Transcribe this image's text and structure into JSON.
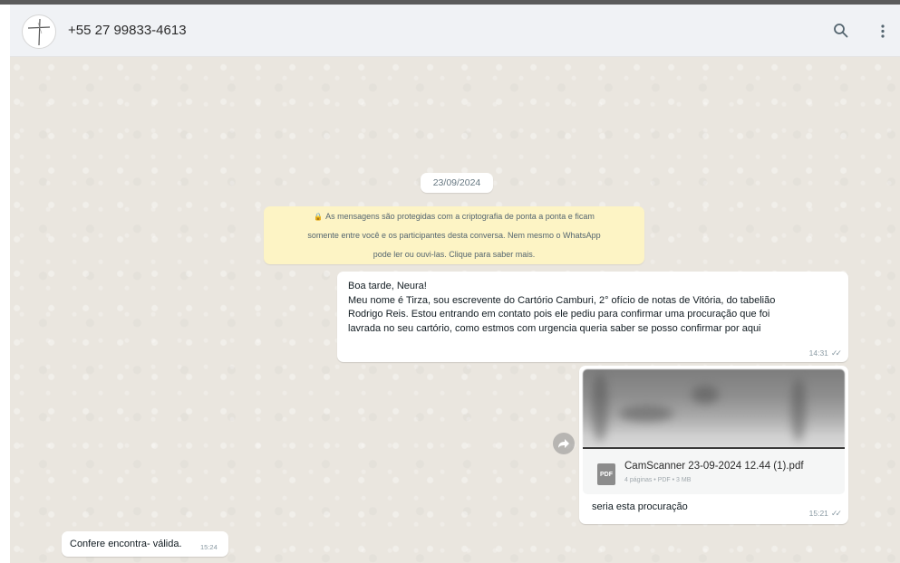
{
  "header": {
    "contact_name": "+55 27 99833-4613",
    "search_icon": "search-icon",
    "menu_icon": "kebab-menu-icon"
  },
  "chat": {
    "date_divider": "23/09/2024",
    "encryption_notice": {
      "icon": "lock-icon",
      "lines": [
        "As mensagens são protegidas com a criptografia de ponta a ponta e ficam",
        "somente entre você e os participantes desta conversa. Nem mesmo o WhatsApp",
        "pode ler ou ouvi-las. Clique para saber mais."
      ]
    },
    "messages": [
      {
        "direction": "outgoing",
        "lines": [
          "Boa tarde, Neura!",
          "Meu nome é Tirza, sou escrevente do Cartório Camburi, 2° ofício de notas de Vitória, do tabelião",
          "Rodrigo Reis. Estou entrando em contato pois ele pediu para confirmar uma procuração que foi",
          "lavrada no seu cartório, como estmos com urgencia queria saber se posso confirmar por aqui"
        ],
        "time": "14:31",
        "status": "read"
      },
      {
        "direction": "outgoing",
        "type": "document",
        "file_icon": "PDF",
        "file_name": "CamScanner 23-09-2024 12.44 (1).pdf",
        "file_meta": "4 páginas • PDF • 3 MB",
        "caption": "seria esta procuração",
        "time": "15:21",
        "status": "read"
      },
      {
        "direction": "incoming",
        "text": "Confere encontra- válida.",
        "time": "15:24"
      }
    ],
    "forward_icon": "forward-icon"
  },
  "colors": {
    "chat_background": "#eae6df",
    "header_background": "#f0f2f5",
    "bubble_background": "#ffffff",
    "encryption_background": "#fdf4c5",
    "ticks_color": "#8a9aa3"
  }
}
